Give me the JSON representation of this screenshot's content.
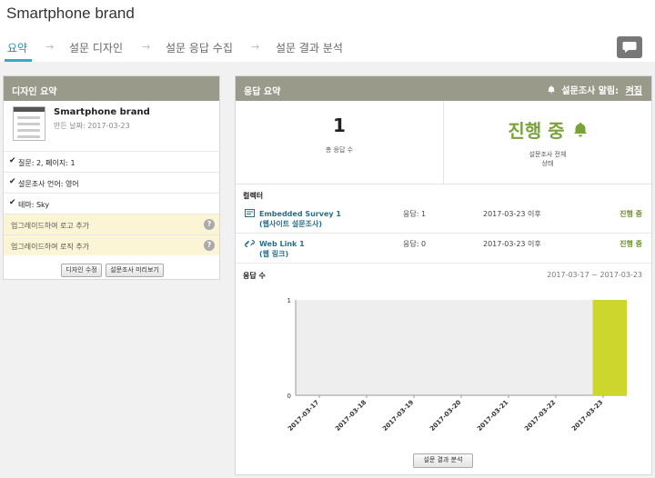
{
  "header": {
    "title": "Smartphone brand",
    "tabs": [
      {
        "label": "요약"
      },
      {
        "label": "설문 디자인"
      },
      {
        "label": "설문 응답 수집"
      },
      {
        "label": "설문 결과 분석"
      }
    ]
  },
  "design_summary": {
    "title": "디자인 요약",
    "survey_name": "Smartphone brand",
    "created": "만든 날짜: 2017-03-23",
    "rows": [
      "질문: 2, 페이지: 1",
      "설문조사 언어: 영어",
      "테마: Sky"
    ],
    "upgrade_rows": [
      "업그레이드하여 로고 추가",
      "업그레이드하여 로직 추가"
    ],
    "edit_button": "디자인 수정",
    "preview_button": "설문조사 미리보기"
  },
  "response_summary": {
    "title": "응답 요약",
    "notify_label": "설문조사 알림:",
    "notify_value": "켜짐",
    "total_responses": "1",
    "total_responses_label": "총 응답 수",
    "status": "진행 중",
    "status_label_1": "설문조사 전체",
    "status_label_2": "상태",
    "collectors_title": "컬렉터",
    "collectors": [
      {
        "name_1": "Embedded Survey 1",
        "name_2": "(웹사이트 설문조사)",
        "responses": "응답: 1",
        "date": "2017-03-23 이후",
        "status": "진행 중",
        "icon": "embed-icon"
      },
      {
        "name_1": "Web Link 1",
        "name_2": "(웹 링크)",
        "responses": "응답: 0",
        "date": "2017-03-23 이후",
        "status": "진행 중",
        "icon": "link-icon"
      }
    ],
    "responses_title": "응답 수",
    "date_range": "2017-03-17 ~ 2017-03-23",
    "analyze_button": "설문 결과 분석"
  },
  "chart_data": {
    "type": "bar",
    "categories": [
      "2017-03-17",
      "2017-03-18",
      "2017-03-19",
      "2017-03-20",
      "2017-03-21",
      "2017-03-22",
      "2017-03-23"
    ],
    "values": [
      0,
      0,
      0,
      0,
      0,
      0,
      1
    ],
    "ylim": [
      0,
      1
    ],
    "y_ticks": [
      "0",
      "1"
    ],
    "bar_color": "#cdd62c",
    "plot_background": "#eeeeee"
  }
}
